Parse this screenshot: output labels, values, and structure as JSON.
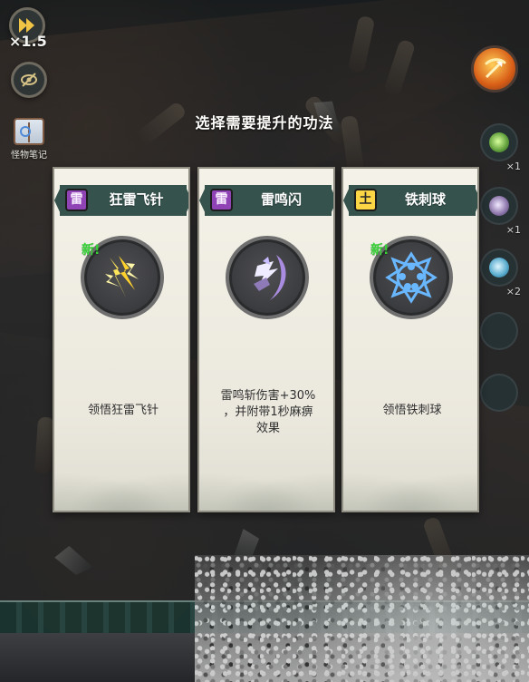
{
  "hud": {
    "speed_label": "×1.5",
    "bestiary_label": "怪物笔记",
    "right_counts": [
      "×1",
      "×1",
      "×2"
    ]
  },
  "dialog": {
    "title": "选择需要提升的功法"
  },
  "cards": [
    {
      "element": "雷",
      "element_icon": "thunder-element-icon",
      "name": "狂雷飞针",
      "badge": "新!",
      "description": "领悟狂雷飞针",
      "icon": "thunder-needle-icon"
    },
    {
      "element": "雷",
      "element_icon": "thunder-element-icon",
      "name": "雷鸣闪",
      "badge": "",
      "description": "雷鸣斩伤害+30%\n，并附带1秒麻痹\n效果",
      "icon": "thunder-slash-icon"
    },
    {
      "element": "土",
      "element_icon": "earth-element-icon",
      "name": "铁刺球",
      "badge": "新!",
      "description": "领悟铁刺球",
      "icon": "iron-spike-ball-icon"
    }
  ],
  "colors": {
    "card_header": "#35524d",
    "thunder_element": "#8f43b4",
    "earth_element": "#fdd646",
    "new_badge": "#36d136",
    "title_text": "#fffefb"
  }
}
